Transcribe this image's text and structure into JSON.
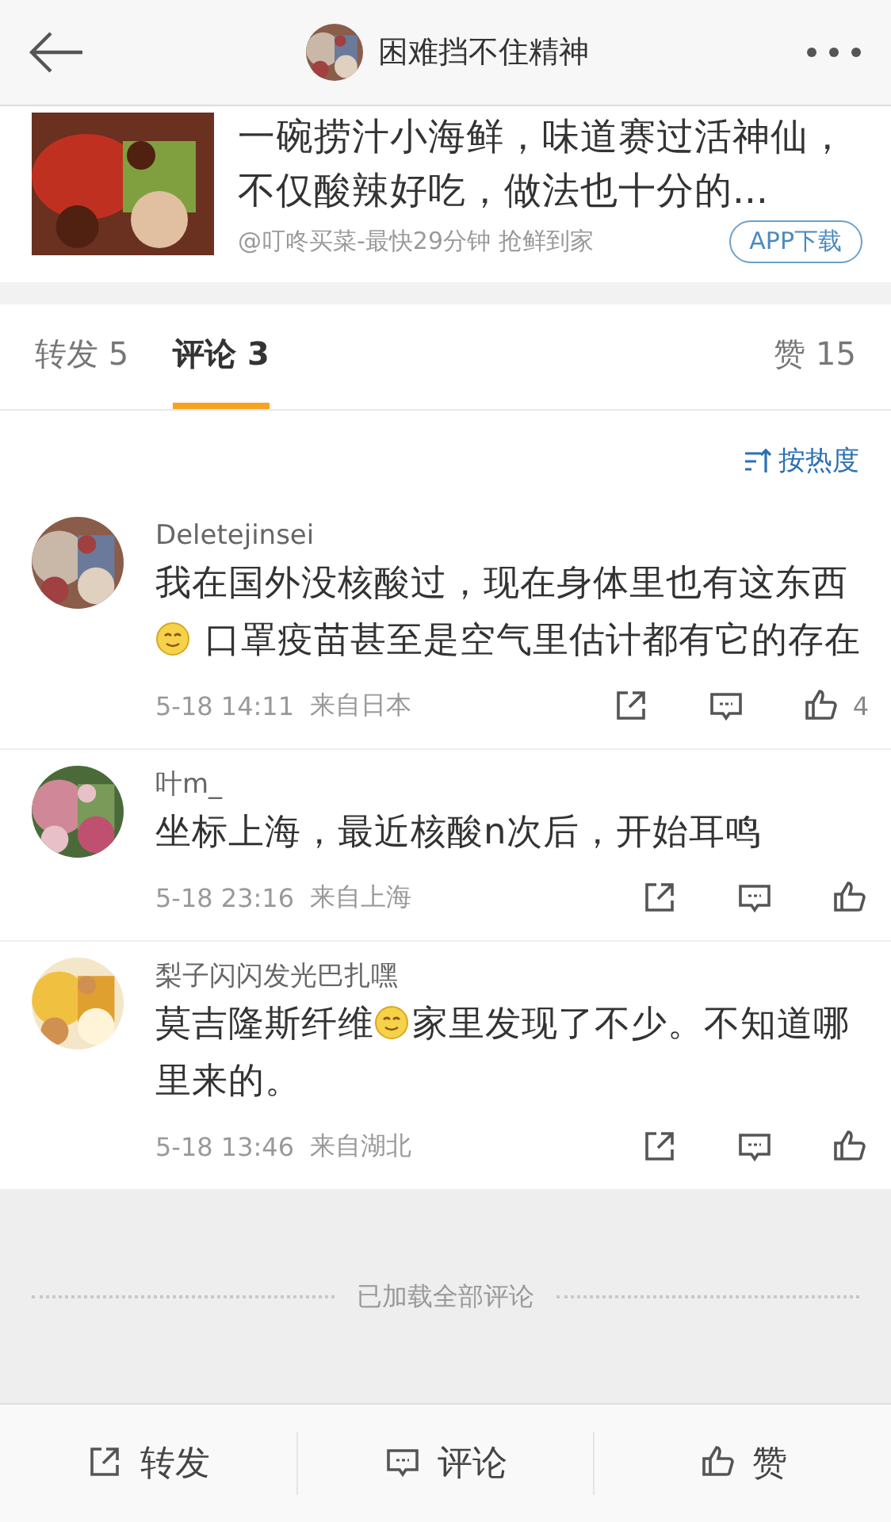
{
  "header": {
    "title": "困难挡不住精神"
  },
  "post_card": {
    "kind": "picture",
    "title": "一碗捞汁小海鲜，味道赛过活神仙，不仅酸辣好吃，做法也十分的...",
    "source": "@叮咚买菜-最快29分钟 抢鲜到家",
    "button": "APP下载"
  },
  "tabs": [
    {
      "label": "转发 5",
      "selected": false
    },
    {
      "label": "评论 3",
      "selected": true
    },
    {
      "label": "赞 15",
      "selected": false
    }
  ],
  "sort": {
    "label": "按热度"
  },
  "comments": [
    {
      "user": "Deletejinsei",
      "text_parts": [
        {
          "kind": "text",
          "text": "我在国外没核酸过，现在身体里也有这东西"
        },
        {
          "kind": "emoji"
        },
        {
          "kind": "text",
          "text": " 口罩疫苗甚至是空气里估计都有它的存在"
        }
      ],
      "time": "5-18 14:11",
      "origin": "来自日本",
      "likes": "4"
    },
    {
      "user": "叶m_",
      "text_parts": [
        {
          "kind": "text",
          "text": "坐标上海，最近核酸n次后，开始耳鸣"
        }
      ],
      "time": "5-18 23:16",
      "origin": "来自上海"
    },
    {
      "user": "梨子闪闪发光巴扎嘿",
      "text_parts": [
        {
          "kind": "text",
          "text": "莫吉隆斯纤维"
        },
        {
          "kind": "emoji"
        },
        {
          "kind": "text",
          "text": "家里发现了不少。不知道哪里来的。"
        }
      ],
      "time": "5-18 13:46",
      "origin": "来自湖北"
    }
  ],
  "footer_note": "已加载全部评论",
  "bottom_bar": [
    {
      "kind": "repost",
      "label": "转发"
    },
    {
      "kind": "comment",
      "label": "评论"
    },
    {
      "kind": "like",
      "label": "赞"
    }
  ]
}
